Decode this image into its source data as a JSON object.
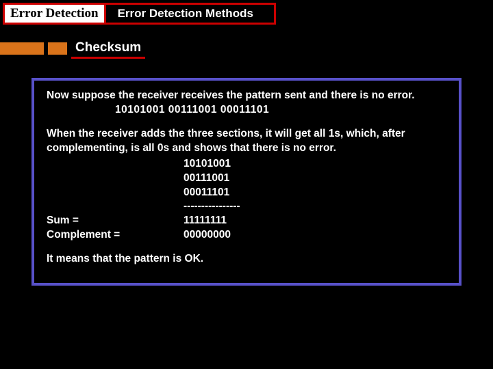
{
  "header": {
    "left_title": "Error Detection",
    "right_title": "Error Detection Methods"
  },
  "subheader": {
    "label": "Checksum"
  },
  "content": {
    "intro": "Now suppose the receiver receives the pattern sent and there is no error.",
    "pattern_line": "10101001   00111001   00011101",
    "explanation": "When the receiver adds the three sections, it will get all 1s, which, after complementing, is all 0s and shows that there is no error.",
    "calc": {
      "r1": "10101001",
      "r2": "00111001",
      "r3": "00011101",
      "divider": "----------------",
      "sum_label": "Sum =",
      "sum_value": "11111111",
      "comp_label": "Complement =",
      "comp_value": "00000000"
    },
    "conclusion": "It means that the pattern is OK."
  }
}
